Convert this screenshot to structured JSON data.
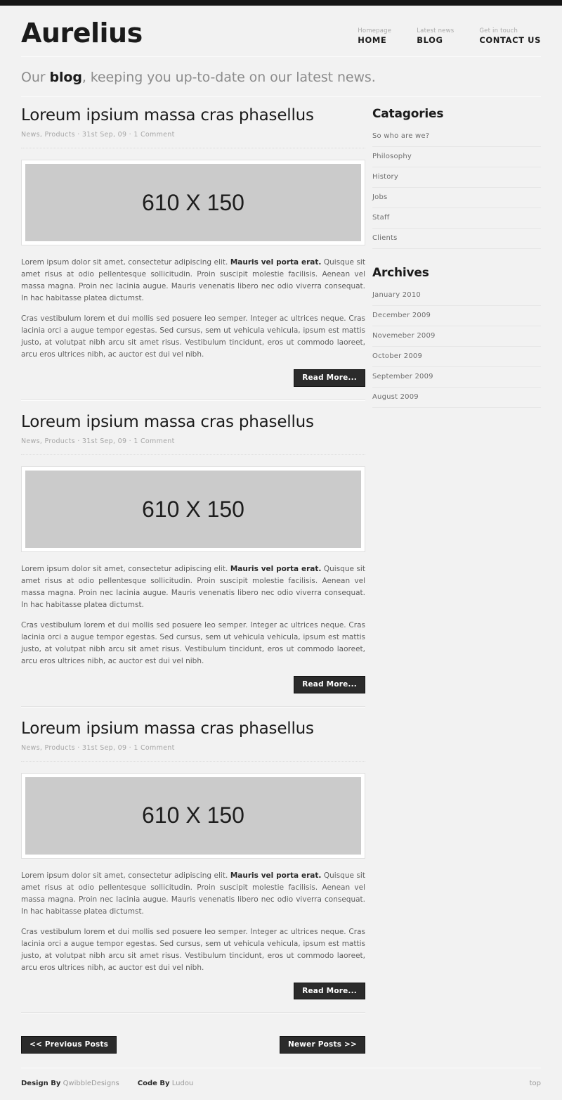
{
  "site": {
    "logo": "Aurelius",
    "tagline_prefix": "Our ",
    "tagline_bold": "blog",
    "tagline_suffix": ", keeping you up-to-date on our latest news."
  },
  "nav": [
    {
      "sub": "Homepage",
      "main": "HOME"
    },
    {
      "sub": "Latest news",
      "main": "BLOG"
    },
    {
      "sub": "Get in touch",
      "main": "CONTACT US"
    }
  ],
  "posts": [
    {
      "title": "Loreum ipsium massa cras phasellus",
      "categories": "News, Products",
      "date": "31st Sep, 09",
      "comments": "1 Comment",
      "sep": "·",
      "thumb_label": "610 X 150",
      "para1_a": "Lorem ipsum dolor sit amet, consectetur adipiscing elit. ",
      "para1_b": "Mauris vel porta erat.",
      "para1_c": " Quisque sit amet risus at odio pellentesque sollicitudin. Proin suscipit molestie facilisis. Aenean vel massa magna. Proin nec lacinia augue. Mauris venenatis libero nec odio viverra consequat. In hac habitasse platea dictumst.",
      "para2": "Cras vestibulum lorem et dui mollis sed posuere leo semper. Integer ac ultrices neque. Cras lacinia orci a augue tempor egestas. Sed cursus, sem ut vehicula vehicula, ipsum est mattis justo, at volutpat nibh arcu sit amet risus. Vestibulum tincidunt, eros ut commodo laoreet, arcu eros ultrices nibh, ac auctor est dui vel nibh.",
      "read_more": "Read More..."
    },
    {
      "title": "Loreum ipsium massa cras phasellus",
      "categories": "News, Products",
      "date": "31st Sep, 09",
      "comments": "1 Comment",
      "sep": "·",
      "thumb_label": "610 X 150",
      "para1_a": "Lorem ipsum dolor sit amet, consectetur adipiscing elit. ",
      "para1_b": "Mauris vel porta erat.",
      "para1_c": " Quisque sit amet risus at odio pellentesque sollicitudin. Proin suscipit molestie facilisis. Aenean vel massa magna. Proin nec lacinia augue. Mauris venenatis libero nec odio viverra consequat. In hac habitasse platea dictumst.",
      "para2": "Cras vestibulum lorem et dui mollis sed posuere leo semper. Integer ac ultrices neque. Cras lacinia orci a augue tempor egestas. Sed cursus, sem ut vehicula vehicula, ipsum est mattis justo, at volutpat nibh arcu sit amet risus. Vestibulum tincidunt, eros ut commodo laoreet, arcu eros ultrices nibh, ac auctor est dui vel nibh.",
      "read_more": "Read More..."
    },
    {
      "title": "Loreum ipsium massa cras phasellus",
      "categories": "News, Products",
      "date": "31st Sep, 09",
      "comments": "1 Comment",
      "sep": "·",
      "thumb_label": "610 X 150",
      "para1_a": "Lorem ipsum dolor sit amet, consectetur adipiscing elit. ",
      "para1_b": "Mauris vel porta erat.",
      "para1_c": " Quisque sit amet risus at odio pellentesque sollicitudin. Proin suscipit molestie facilisis. Aenean vel massa magna. Proin nec lacinia augue. Mauris venenatis libero nec odio viverra consequat. In hac habitasse platea dictumst.",
      "para2": "Cras vestibulum lorem et dui mollis sed posuere leo semper. Integer ac ultrices neque. Cras lacinia orci a augue tempor egestas. Sed cursus, sem ut vehicula vehicula, ipsum est mattis justo, at volutpat nibh arcu sit amet risus. Vestibulum tincidunt, eros ut commodo laoreet, arcu eros ultrices nibh, ac auctor est dui vel nibh.",
      "read_more": "Read More..."
    }
  ],
  "sidebar": {
    "categories_title": "Catagories",
    "categories": [
      "So who are we?",
      "Philosophy",
      "History",
      "Jobs",
      "Staff",
      "Clients"
    ],
    "archives_title": "Archives",
    "archives": [
      "January 2010",
      "December 2009",
      "Novemeber 2009",
      "October 2009",
      "September 2009",
      "August 2009"
    ]
  },
  "pagination": {
    "previous": "<< Previous Posts",
    "newer": "Newer Posts >>"
  },
  "footer": {
    "design_by_label": "Design By",
    "design_by_name": "QwibbleDesigns",
    "code_by_label": "Code By",
    "code_by_name": "Ludou",
    "top": "top"
  },
  "colors": {
    "topbar": "#161616",
    "page_bg": "#f2f2f2",
    "button_bg": "#2b2b2b",
    "thumb_bg": "#cbcbcb",
    "heading": "#1b1b1b",
    "muted": "#a6a6a6"
  }
}
